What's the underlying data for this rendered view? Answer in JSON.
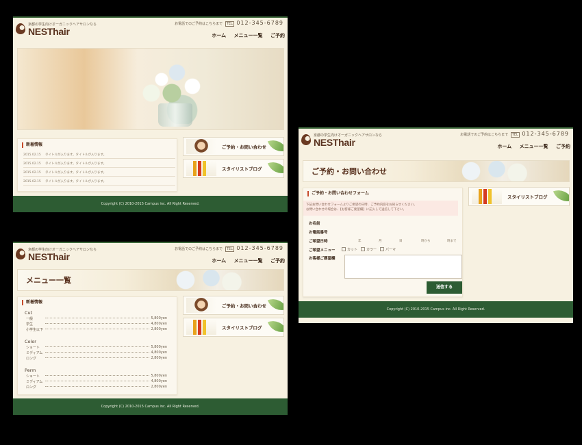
{
  "site": {
    "tagline": "京都の学生向けオーガニックヘアサロンなら",
    "logo": "NESThair",
    "contact_prefix": "お電話でのご予約はこちらまで",
    "phone_badge": "TEL",
    "phone": "012-345-6789",
    "nav": [
      "ホーム",
      "メニュー一覧",
      "ご予約"
    ],
    "banners": {
      "reserve": "ご予約・お問い合わせ",
      "blog": "スタイリストブログ"
    },
    "footer": "Copyright (C) 2010-2015 Campus inc. All Right Reserved."
  },
  "home": {
    "news_title": "新着情報",
    "news": [
      {
        "date": "2015.02.15",
        "text": "タイトルが入ります。タイトルが入ります。"
      },
      {
        "date": "2015.02.15",
        "text": "タイトルが入ります。タイトルが入ります。"
      },
      {
        "date": "2015.02.15",
        "text": "タイトルが入ります。タイトルが入ります。"
      },
      {
        "date": "2015.02.15",
        "text": "タイトルが入ります。タイトルが入ります。"
      }
    ]
  },
  "menu_page": {
    "title": "メニュー一覧",
    "panel_title": "新着情報",
    "categories": [
      {
        "name": "Cut",
        "items": [
          {
            "name": "一般",
            "price": "5,800yen"
          },
          {
            "name": "学生",
            "price": "4,800yen"
          },
          {
            "name": "小学生以下",
            "price": "2,800yen"
          }
        ]
      },
      {
        "name": "Color",
        "items": [
          {
            "name": "ショート",
            "price": "5,800yen"
          },
          {
            "name": "ミディアム",
            "price": "4,800yen"
          },
          {
            "name": "ロング",
            "price": "2,800yen"
          }
        ]
      },
      {
        "name": "Perm",
        "items": [
          {
            "name": "ショート",
            "price": "5,800yen"
          },
          {
            "name": "ミディアム",
            "price": "4,800yen"
          },
          {
            "name": "ロング",
            "price": "2,800yen"
          }
        ]
      }
    ]
  },
  "contact_page": {
    "title": "ご予約・お問い合わせ",
    "form_title": "ご予約・お問い合わせフォーム",
    "note_line1": "下記お問い合わせフォームよりご希望の日時、ご予約内容をお知らせください。",
    "note_line2": "お問い合わせの場合は、【お客様ご要望欄】に記入して送信して下さい。",
    "labels": {
      "name": "お名前",
      "phone": "お電話番号",
      "datetime": "ご希望日時",
      "menu": "ご希望メニュー",
      "request": "お客様ご要望欄"
    },
    "date_units": [
      "年",
      "月",
      "日",
      "時から",
      "時まで"
    ],
    "menu_options": [
      "カット",
      "カラー",
      "パーマ"
    ],
    "submit": "送信する"
  }
}
